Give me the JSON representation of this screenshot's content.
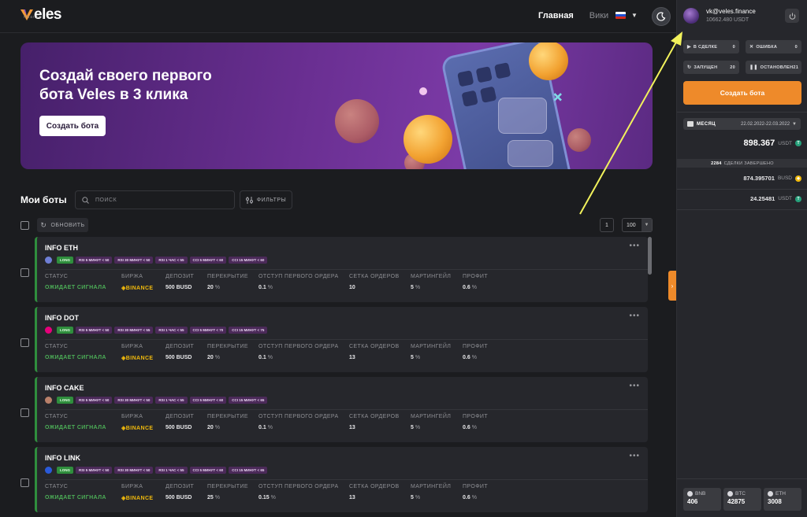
{
  "header": {
    "logo_text": "eles",
    "logo_sub": "finance",
    "nav": {
      "home": "Главная",
      "wiki": "Вики"
    },
    "language": "ru"
  },
  "banner": {
    "title": "Создай своего первого бота Veles в 3 клика",
    "button": "Создать бота"
  },
  "bots": {
    "title": "Мои боты",
    "search_placeholder": "ПОИСК",
    "filters_label": "ФИЛЬТРЫ",
    "refresh_label": "ОБНОВИТЬ",
    "page": "1",
    "per_page": "100",
    "columns": {
      "status": "СТАТУС",
      "exchange": "БИРЖА",
      "deposit": "ДЕПОЗИТ",
      "overlap": "ПЕРЕКРЫТИЕ",
      "first_order_offset": "ОТСТУП ПЕРВОГО ОРДЕРА",
      "order_grid": "СЕТКА ОРДЕРОВ",
      "martingale": "МАРТИНГЕЙЛ",
      "profit": "ПРОФИТ"
    },
    "items": [
      {
        "name": "INFO ETH",
        "coin_color": "#6f7fd6",
        "tags": [
          "LONG",
          "RSI 5 МИНУТ < 50",
          "RSI 30 МИНУТ < 50",
          "RSI 1 ЧАС < 55",
          "CCI 5 МИНУТ < 60",
          "CCI 15 МИНУТ < 60"
        ],
        "status": "ОЖИДАЕТ СИГНАЛА",
        "exchange": "BINANCE",
        "deposit": "500 BUSD",
        "overlap": "20",
        "first_order_offset": "0.1",
        "order_grid": "10",
        "martingale": "5",
        "profit": "0.6",
        "unit": "%"
      },
      {
        "name": "INFO DOT",
        "coin_color": "#e6007a",
        "tags": [
          "LONG",
          "RSI 5 МИНУТ < 50",
          "RSI 30 МИНУТ < 55",
          "RSI 1 ЧАС < 55",
          "CCI 5 МИНУТ < 70",
          "CCI 15 МИНУТ < 75"
        ],
        "status": "ОЖИДАЕТ СИГНАЛА",
        "exchange": "BINANCE",
        "deposit": "500 BUSD",
        "overlap": "20",
        "first_order_offset": "0.1",
        "order_grid": "13",
        "martingale": "5",
        "profit": "0.6",
        "unit": "%"
      },
      {
        "name": "INFO CAKE",
        "coin_color": "#b9806a",
        "tags": [
          "LONG",
          "RSI 5 МИНУТ < 50",
          "RSI 30 МИНУТ < 50",
          "RSI 1 ЧАС < 55",
          "CCI 5 МИНУТ < 60",
          "CCI 15 МИНУТ < 65"
        ],
        "status": "ОЖИДАЕТ СИГНАЛА",
        "exchange": "BINANCE",
        "deposit": "500 BUSD",
        "overlap": "20",
        "first_order_offset": "0.1",
        "order_grid": "13",
        "martingale": "5",
        "profit": "0.6",
        "unit": "%"
      },
      {
        "name": "INFO LINK",
        "coin_color": "#2a5ada",
        "tags": [
          "LONG",
          "RSI 5 МИНУТ < 50",
          "RSI 30 МИНУТ < 50",
          "RSI 1 ЧАС < 55",
          "CCI 5 МИНУТ < 60",
          "CCI 15 МИНУТ < 65"
        ],
        "status": "ОЖИДАЕТ СИГНАЛА",
        "exchange": "BINANCE",
        "deposit": "500 BUSD",
        "overlap": "25",
        "first_order_offset": "0.15",
        "order_grid": "13",
        "martingale": "5",
        "profit": "0.6",
        "unit": "%"
      }
    ]
  },
  "panel": {
    "email": "vk@veles.finance",
    "balance": "10662.480 USDT",
    "statuses": [
      {
        "icon": "▶",
        "label": "В СДЕЛКЕ",
        "count": "0"
      },
      {
        "icon": "✕",
        "label": "ОШИБКА",
        "count": "0"
      },
      {
        "icon": "↻",
        "label": "ЗАПУЩЕН",
        "count": "20"
      },
      {
        "icon": "❚❚",
        "label": "ОСТАНОВЛЕН",
        "count": "21"
      }
    ],
    "create_button": "Создать бота",
    "period": {
      "label": "МЕСЯЦ",
      "dates": "22.02.2022-22.03.2022"
    },
    "total": {
      "value": "898.367",
      "currency": "USDT",
      "icon_color": "#26a17b"
    },
    "deals": {
      "count": "2284",
      "label": "СДЕЛКИ ЗАВЕРШЕНО"
    },
    "breakdown": [
      {
        "value": "874.395701",
        "currency": "BUSD",
        "icon_color": "#f0b90b"
      },
      {
        "value": "24.25481",
        "currency": "USDT",
        "icon_color": "#26a17b"
      }
    ],
    "tickers": [
      {
        "name": "BNB",
        "value": "406"
      },
      {
        "name": "BTC",
        "value": "42875"
      },
      {
        "name": "ETH",
        "value": "3008"
      }
    ]
  },
  "colors": {
    "accent": "#ee8a2a",
    "status_green": "#4cae57",
    "binance_yellow": "#f0b90b",
    "annotation_arrow": "#f2f25c"
  }
}
